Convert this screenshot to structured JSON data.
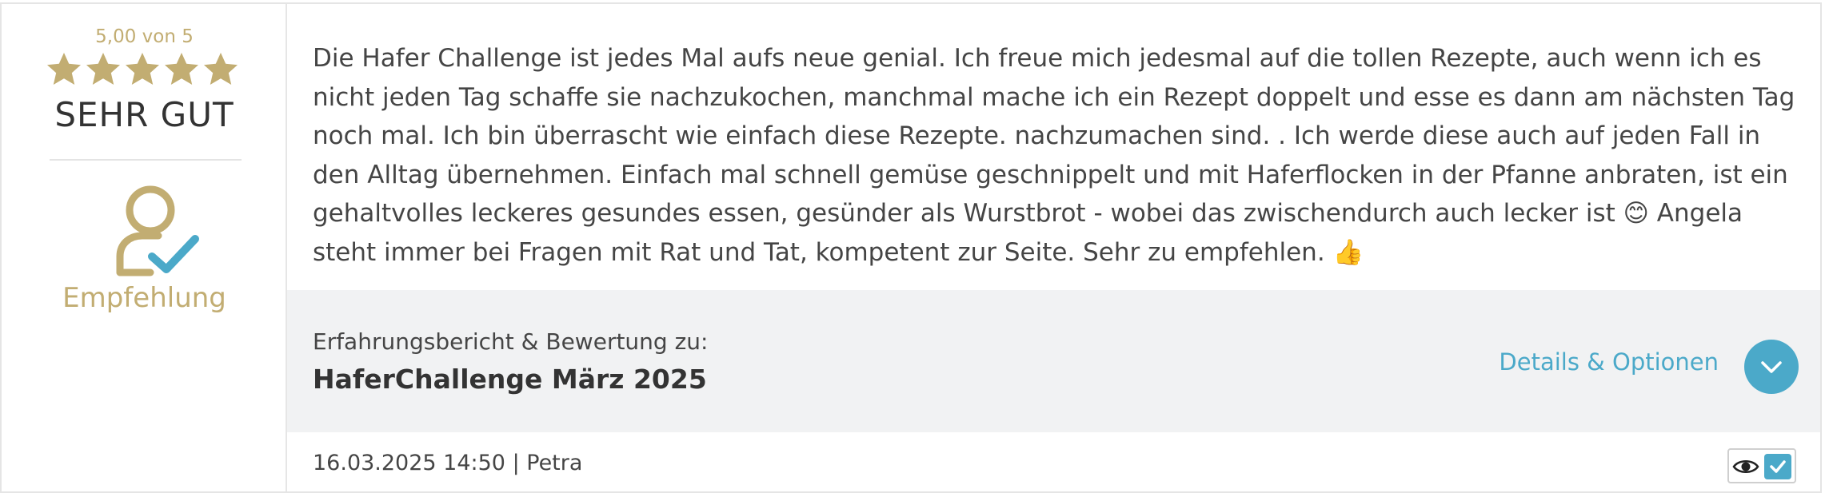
{
  "rating": {
    "score_text": "5,00 von 5",
    "score": 5.0,
    "max": 5,
    "verdict": "SEHR GUT",
    "star_color": "#c2ad72"
  },
  "recommendation": {
    "label": "Empfehlung",
    "icon": "user-check-icon",
    "accent_color": "#4ba9c9"
  },
  "review": {
    "text": "Die Hafer Challenge ist jedes Mal aufs neue genial. Ich freue mich jedesmal auf die tollen Rezepte, auch wenn ich es nicht jeden Tag schaffe sie nachzukochen, manchmal mache ich ein Rezept doppelt und esse es dann am nächsten Tag noch mal. Ich bin überrascht wie einfach diese Rezepte. nachzumachen sind. . Ich werde diese auch auf jeden Fall in den Alltag übernehmen. Einfach mal schnell gemüse geschnippelt und mit Haferflocken in der Pfanne anbraten, ist ein gehaltvolles leckeres gesundes essen, gesünder als Wurstbrot - wobei das zwischendurch auch lecker ist 😊 Angela steht immer bei Fragen mit Rat und Tat, kompetent zur Seite. Sehr zu empfehlen. 👍"
  },
  "about": {
    "prefix": "Erfahrungsbericht & Bewertung zu:",
    "title": "HaferChallenge März 2025"
  },
  "details": {
    "label": "Details & Optionen",
    "toggle_icon": "chevron-down-icon"
  },
  "meta": {
    "text": "16.03.2025 14:50 | Petra"
  },
  "actions": {
    "view_icon": "eye-icon",
    "verified_icon": "checkmark-icon"
  }
}
